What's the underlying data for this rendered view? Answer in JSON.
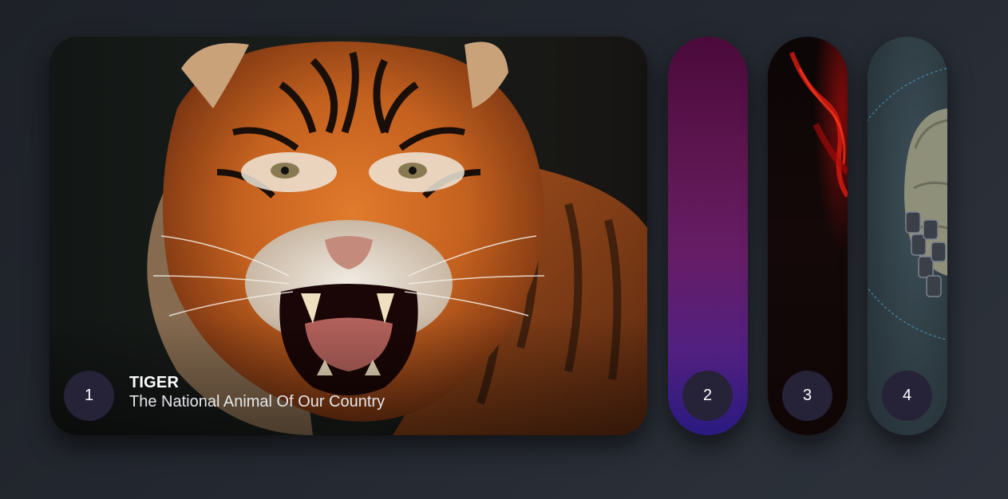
{
  "cards": [
    {
      "number": "1",
      "title": "TIGER",
      "subtitle": "The National Animal Of Our Country",
      "image": "tiger-roaring",
      "active": true
    },
    {
      "number": "2",
      "image": "purple-gradient"
    },
    {
      "number": "3",
      "image": "red-smoke-dark"
    },
    {
      "number": "4",
      "image": "robot-skull"
    }
  ],
  "colors": {
    "background": "#23272f",
    "badge": "#262238",
    "text": "#ffffff"
  }
}
